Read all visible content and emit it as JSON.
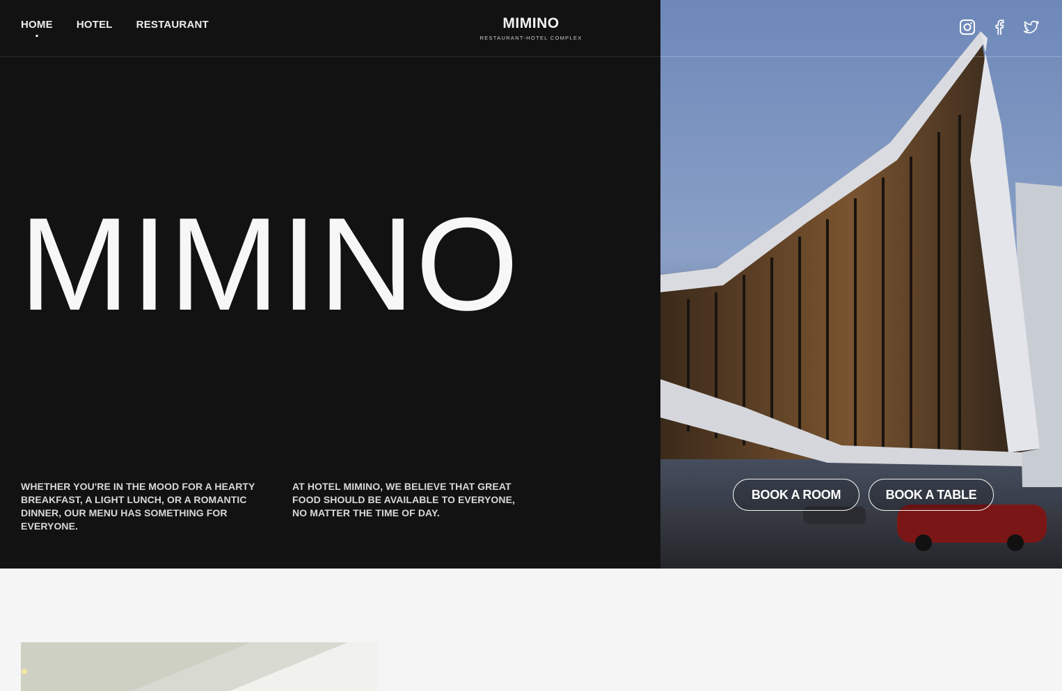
{
  "nav": {
    "items": [
      {
        "label": "HOME",
        "active": true
      },
      {
        "label": "HOTEL",
        "active": false
      },
      {
        "label": "RESTAURANT",
        "active": false
      }
    ]
  },
  "brand": {
    "name": "MIMINO",
    "tagline": "RESTAURANT-HOTEL COMPLEX"
  },
  "hero": {
    "title": "MIMINO",
    "paragraph_one": "WHETHER YOU'RE IN THE MOOD FOR A HEARTY BREAKFAST, A LIGHT LUNCH, OR A ROMANTIC DINNER, OUR MENU HAS SOMETHING FOR EVERYONE.",
    "paragraph_two": "AT HOTEL MIMINO, WE BELIEVE THAT GREAT FOOD SHOULD BE AVAILABLE TO EVERYONE, NO MATTER THE TIME OF DAY."
  },
  "social": {
    "icons": [
      "instagram-icon",
      "facebook-icon",
      "twitter-icon"
    ]
  },
  "actions": {
    "book_room": "BOOK A ROOM",
    "book_table": "BOOK A TABLE"
  },
  "colors": {
    "background": "#121212",
    "text": "#f7f7f7",
    "lower_section": "#f5f5f5"
  }
}
